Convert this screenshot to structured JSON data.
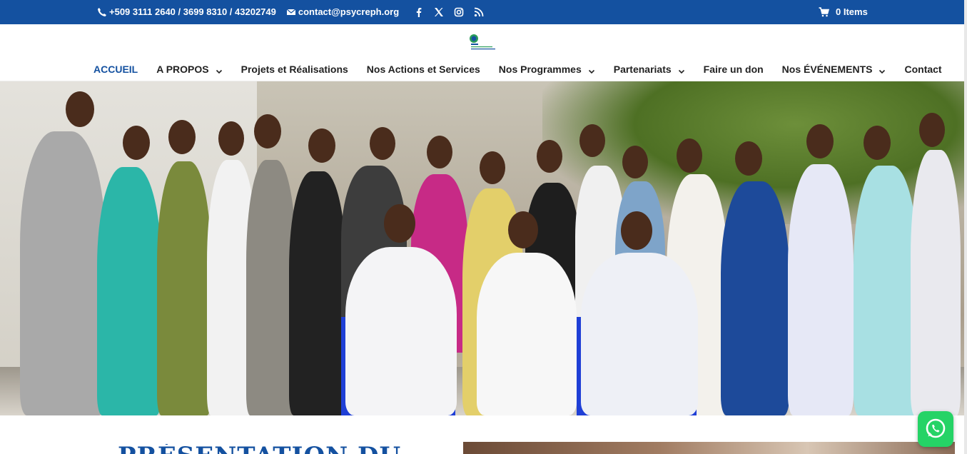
{
  "topbar": {
    "phone": "+509 3111 2640 / 3699 8310 / 43202749",
    "email": "contact@psycreph.org",
    "social": [
      "facebook-icon",
      "x-icon",
      "instagram-icon",
      "rss-icon"
    ],
    "cart": "0 Items"
  },
  "nav": {
    "items": [
      {
        "label": "ACCUEIL",
        "active": true
      },
      {
        "label": "A PROPOS",
        "dropdown": true
      },
      {
        "label": "Projets et Réalisations"
      },
      {
        "label": "Nos Actions et Services"
      },
      {
        "label": "Nos Programmes",
        "dropdown": true
      },
      {
        "label": "Partenariats",
        "dropdown": true
      },
      {
        "label": "Faire un don"
      },
      {
        "label": "Nos ÉVÉNEMENTS",
        "dropdown": true
      },
      {
        "label": "Contact"
      }
    ]
  },
  "section": {
    "title": "PRÉSENTATION DU"
  },
  "colors": {
    "brand": "#1451a0",
    "whatsapp": "#25d366"
  }
}
